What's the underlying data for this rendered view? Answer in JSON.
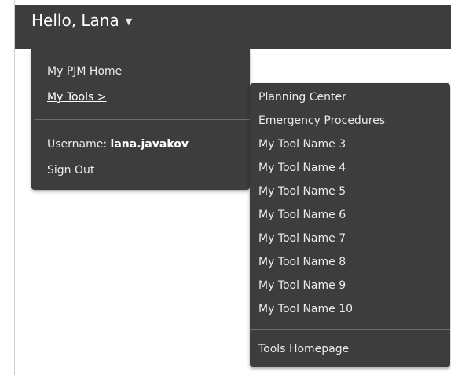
{
  "header": {
    "greeting": "Hello, Lana",
    "caret_icon": "caret-down-icon"
  },
  "account_menu": {
    "home_label": "My PJM Home",
    "tools_label": "My Tools >",
    "username_label": "Username:",
    "username_value": "lana.javakov",
    "signout_label": "Sign Out"
  },
  "tools_menu": {
    "items": [
      "Planning Center",
      "Emergency Procedures",
      "My Tool Name 3",
      "My Tool Name 4",
      "My Tool Name 5",
      "My Tool Name 6",
      "My Tool Name 7",
      "My Tool Name 8",
      "My Tool Name 9",
      "My Tool Name 10"
    ],
    "homepage_label": "Tools Homepage"
  },
  "colors": {
    "menu_background": "#3d3d3d",
    "text": "#ececec",
    "divider": "#6b6b6b"
  }
}
